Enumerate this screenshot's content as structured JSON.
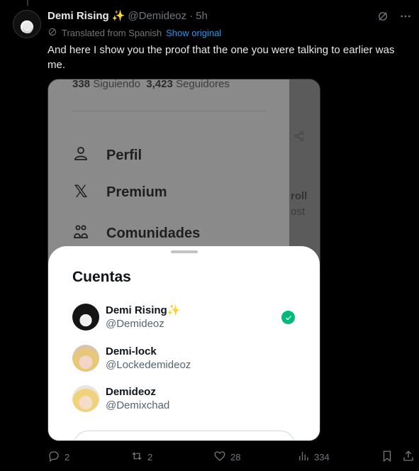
{
  "post": {
    "display_name": "Demi Rising",
    "name_emoji": "✨",
    "handle": "@Demideoz",
    "separator": "·",
    "time": "5h",
    "translated_label": "Translated from Spanish",
    "show_original": "Show original",
    "text": "And here I show you the proof that the one you were talking to earlier was me."
  },
  "screenshot": {
    "following_count": "338",
    "following_label": "Siguiendo",
    "followers_count": "3,423",
    "followers_label": "Seguidores",
    "menu": [
      {
        "label": "Perfil",
        "icon": "person-icon"
      },
      {
        "label": "Premium",
        "icon": "x-logo-icon"
      },
      {
        "label": "Comunidades",
        "icon": "communities-icon"
      }
    ],
    "side_text_1": "roll",
    "side_text_2": "ost",
    "sheet_title": "Cuentas",
    "accounts": [
      {
        "name": "Demi Rising",
        "emoji": "✨",
        "handle": "@Demideoz",
        "active": true
      },
      {
        "name": "Demi-lock",
        "handle": "@Lockedemideoz"
      },
      {
        "name": "Demideoz",
        "handle": "@Demixchad"
      }
    ]
  },
  "actions": {
    "replies": "2",
    "reposts": "2",
    "likes": "28",
    "views": "334"
  }
}
